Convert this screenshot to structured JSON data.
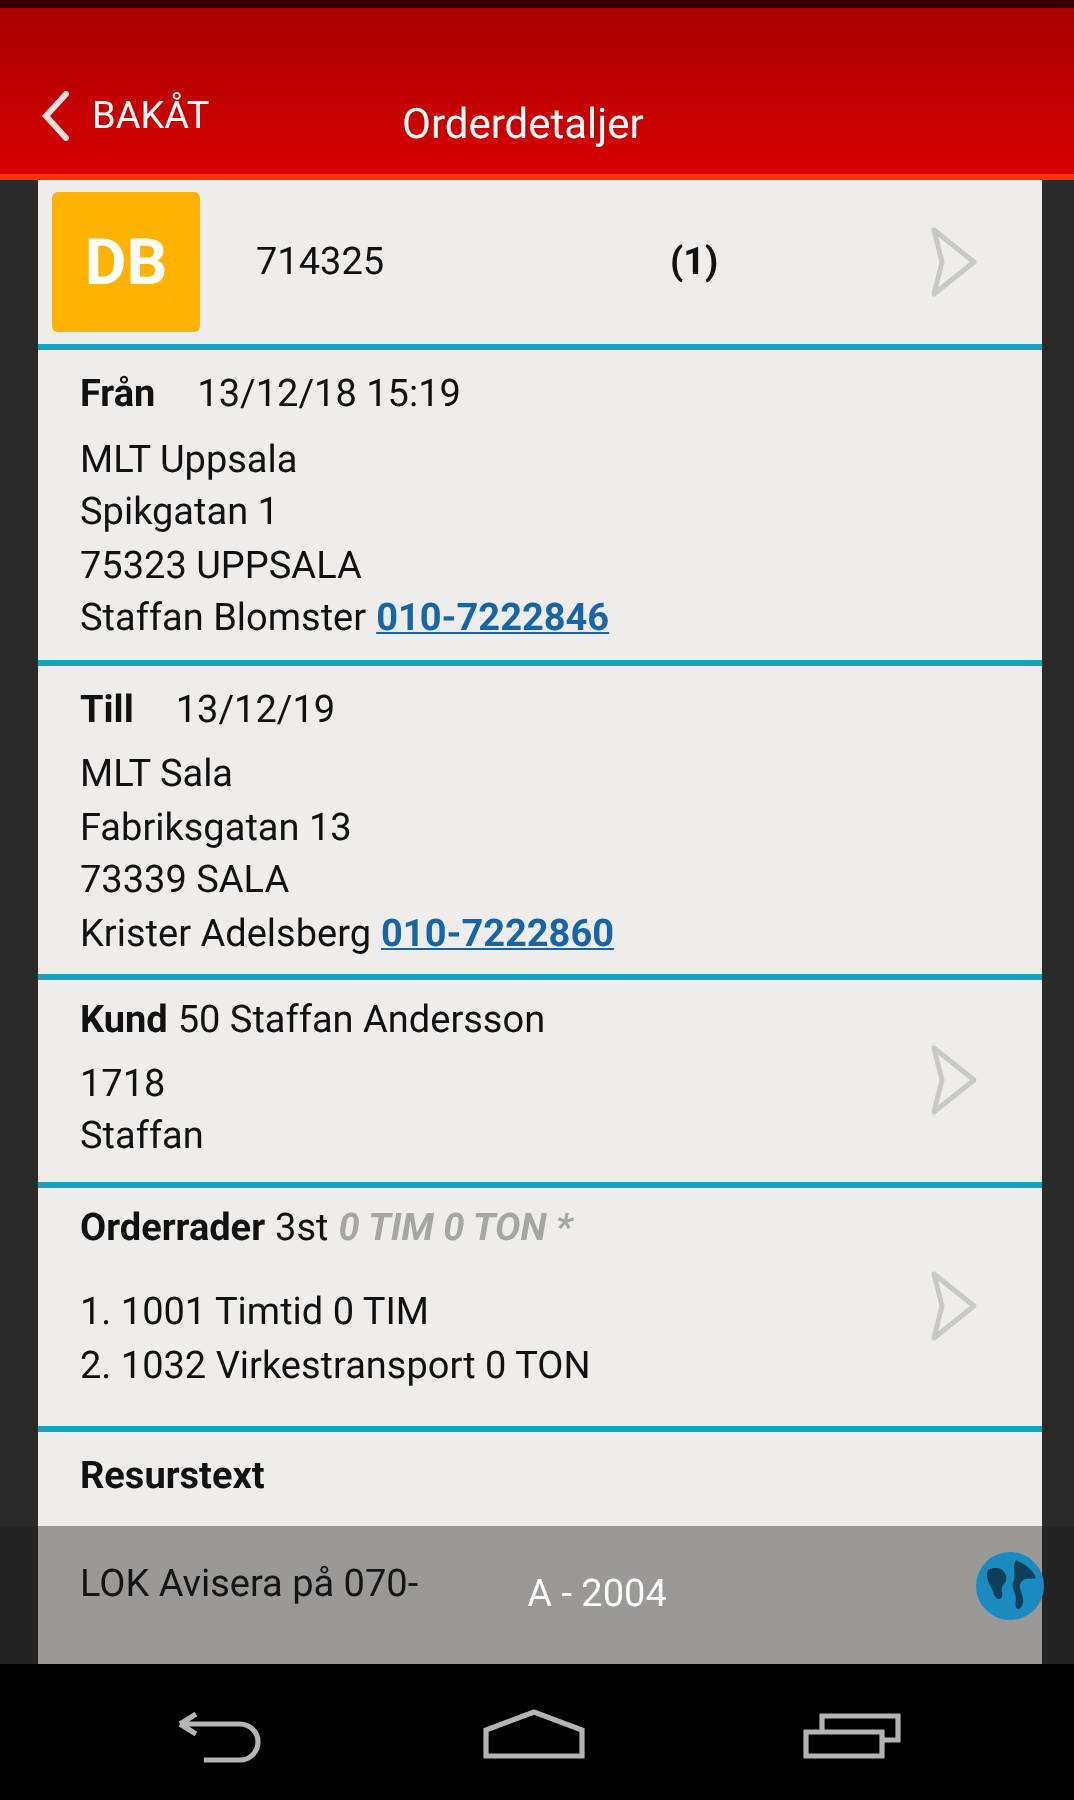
{
  "header": {
    "back_label": "BAKÅT",
    "title": "Orderdetaljer"
  },
  "order": {
    "badge": "DB",
    "number": "714325",
    "count": "(1)"
  },
  "sections": [
    {
      "kind": "address",
      "label": "Från",
      "date": "13/12/18 15:19",
      "lines": [
        "MLT Uppsala",
        "Spikgatan 1",
        "75323 UPPSALA"
      ],
      "contact": "Staffan Blomster",
      "phone": "010-7222846"
    },
    {
      "kind": "address",
      "label": "Till",
      "date": "13/12/19",
      "lines": [
        "MLT Sala",
        "Fabriksgatan 13",
        "73339 SALA"
      ],
      "contact": "Krister Adelsberg",
      "phone": "010-7222860"
    },
    {
      "kind": "customer",
      "label": "Kund",
      "value": "50 Staffan Andersson",
      "lines": [
        "1718",
        "Staffan"
      ]
    },
    {
      "kind": "orderlines",
      "label": "Orderrader",
      "value": "3st",
      "summary": "0 TIM 0 TON *",
      "lines": [
        "1. 1001 Timtid 0 TIM",
        "2. 1032 Virkestransport 0 TON"
      ]
    },
    {
      "kind": "resource",
      "label": "Resurstext",
      "lines": [
        "LOK Avisera på 070-"
      ]
    }
  ],
  "toast": "A - 2004"
}
